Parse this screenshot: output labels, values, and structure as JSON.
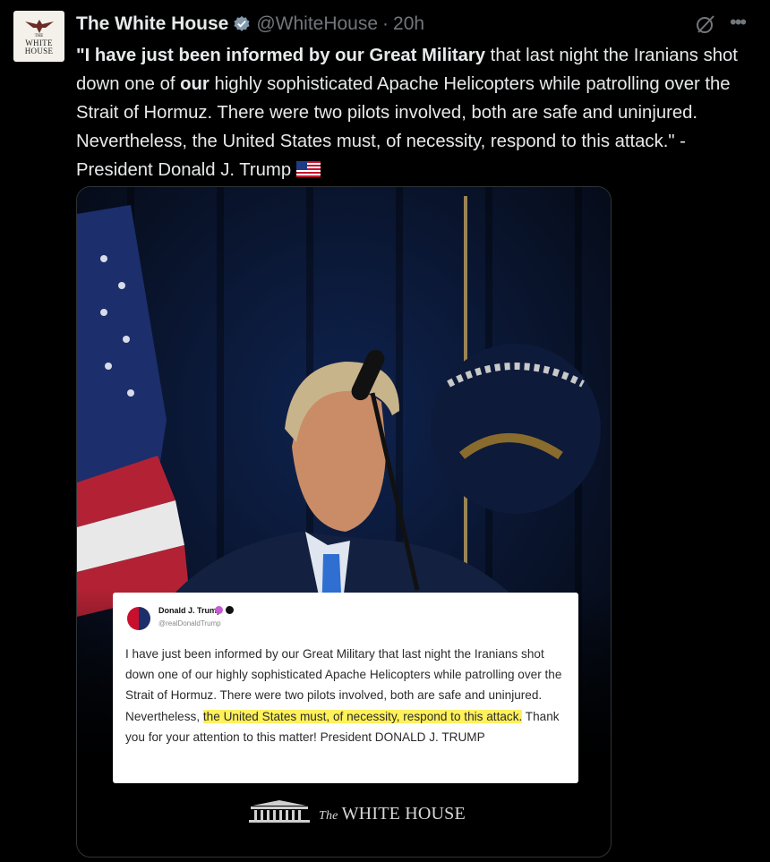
{
  "post": {
    "author_name": "The White House",
    "handle": "@WhiteHouse",
    "separator": "·",
    "time": "20h",
    "avatar_text": {
      "line1": "THE",
      "line2": "WHITE",
      "line3": "HOUSE"
    },
    "text_segments": [
      {
        "t": "\"",
        "b": true
      },
      {
        "t": "I have just been informed by our Great Military",
        "b": true
      },
      {
        "t": " that last night the Iranians shot down one of ",
        "b": false
      },
      {
        "t": "our",
        "b": true
      },
      {
        "t": " highly sophisticated Apache Helicopters while patrolling over the Strait of Hormuz. There were two pilots involved, both are safe and uninjured. Nevertheless, the United States must, of necessity, respond to this attack.\" - President Donald J. Trump",
        "b": false
      }
    ]
  },
  "media": {
    "card": {
      "name": "Donald J. Trump",
      "handle": "@realDonaldTrump",
      "text_before": "I have just been informed by our Great Military that last night the Iranians shot down one of our highly sophisticated Apache Helicopters while patrolling over the Strait of Hormuz. There were two pilots involved, both are safe and uninjured. Nevertheless, ",
      "text_highlight": "the United States must, of necessity, respond to this attack.",
      "text_after": " Thank you for your attention to this matter! President DONALD J. TRUMP"
    },
    "footer": {
      "prefix": "The",
      "title": "WHITE HOUSE"
    }
  },
  "colors": {
    "background": "#000000",
    "text": "#e7e9ea",
    "muted": "#71767b",
    "verified": "#e2b719",
    "highlight": "#fff15c"
  },
  "icons": {
    "verified": "verified-badge-icon",
    "grok": "grok-icon",
    "more": "more-icon",
    "flag": "us-flag-icon"
  }
}
